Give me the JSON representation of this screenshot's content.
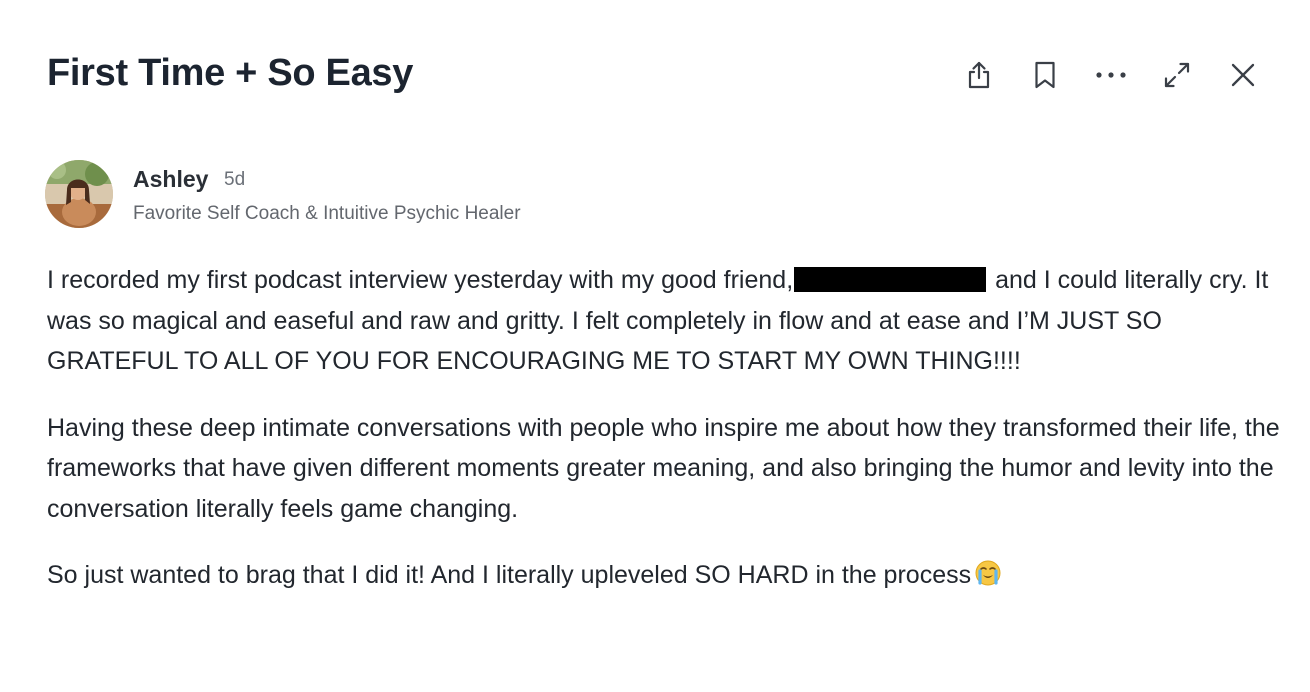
{
  "post": {
    "title": "First Time + So Easy",
    "toolbar": {
      "icons": [
        "share-icon",
        "bookmark-icon",
        "more-icon",
        "expand-icon",
        "close-icon"
      ]
    },
    "author": {
      "name": "Ashley",
      "time": "5d",
      "bio": "Favorite Self Coach & Intuitive Psychic Healer"
    },
    "body": {
      "p1_before": "I recorded my first podcast interview yesterday with my good friend,",
      "p1_after": " and I could literally cry. It was so magical and easeful and raw and gritty. I felt completely in flow and at ease and I’M JUST SO GRATEFUL TO ALL OF YOU FOR ENCOURAGING ME TO START MY OWN THING!!!!",
      "p2": "Having these deep intimate conversations with people who inspire me about how they transformed their life, the frameworks that have given different moments greater meaning, and also bringing the humor and levity into the conversation literally feels game changing.",
      "p3": "So just wanted to brag that I did it! And I literally upleveled SO HARD in the process"
    },
    "emoji": "crying-face-emoji"
  }
}
